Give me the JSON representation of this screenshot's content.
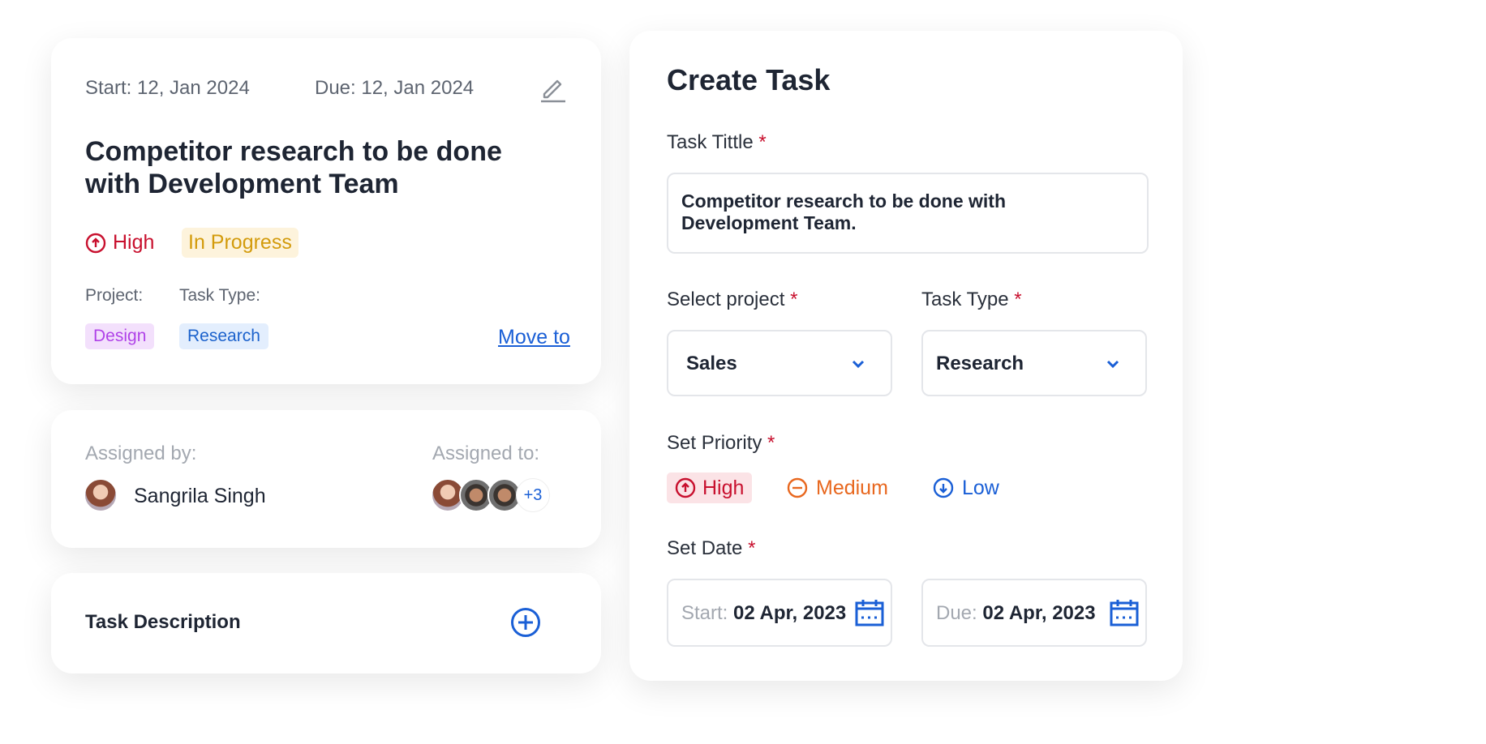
{
  "task_card": {
    "start": "Start: 12, Jan 2024",
    "due": "Due: 12, Jan 2024",
    "title_line1": "Competitor research to be done",
    "title_line2": "with Development Team",
    "priority": "High",
    "status": "In Progress",
    "project_label": "Project:",
    "task_type_label": "Task Type:",
    "project_tag": "Design",
    "task_type_tag": "Research",
    "move_to": "Move to"
  },
  "assign_card": {
    "assigned_by_label": "Assigned by:",
    "assigned_by_name": "Sangrila Singh",
    "assigned_to_label": "Assigned to:",
    "extra_count": "+3"
  },
  "description_card": {
    "label": "Task Description"
  },
  "create_task": {
    "title": "Create Task",
    "task_title_label": "Task Tittle",
    "required": "*",
    "task_title_value_line1": "Competitor research to be done with",
    "task_title_value_line2": "Development Team.",
    "project_label": "Select project",
    "project_value": "Sales",
    "task_type_label": "Task Type",
    "task_type_value": "Research",
    "priority_label": "Set Priority",
    "priorities": [
      "High",
      "Medium",
      "Low"
    ],
    "selected_priority": "High",
    "date_label": "Set Date",
    "start_prefix": "Start:",
    "start_value": "02 Apr, 2023",
    "due_prefix": "Due:",
    "due_value": "02 Apr, 2023"
  },
  "colors": {
    "high": "#c8102e",
    "medium": "#e8671e",
    "low": "#1a5fd6",
    "accent": "#1a5fd6"
  }
}
